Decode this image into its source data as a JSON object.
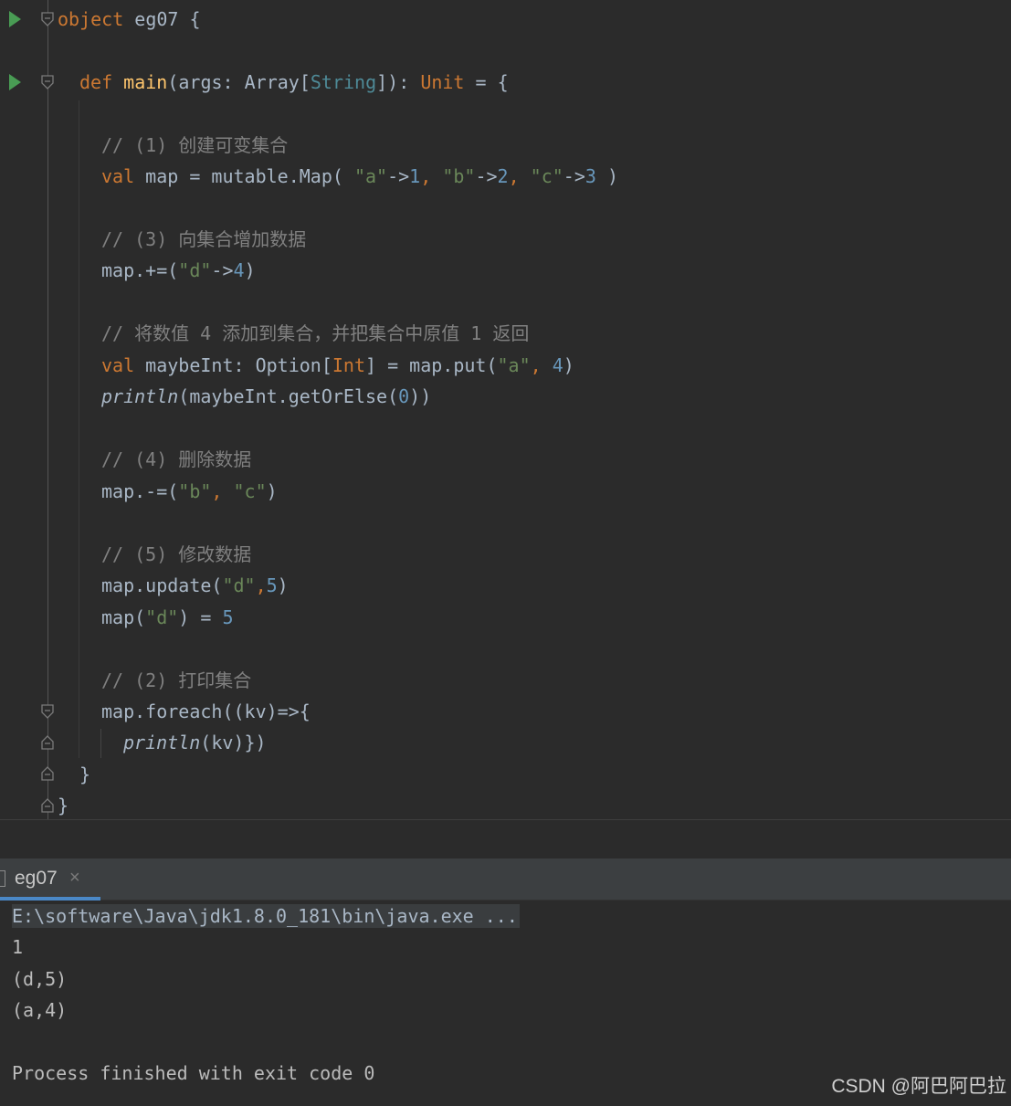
{
  "editor": {
    "lines": {
      "l1_kw": "object",
      "l1_rest": " eg07 {",
      "l2_def": "def",
      "l2_main": "main",
      "l2_a": "(args: Array[",
      "l2_string": "String",
      "l2_b": "]): ",
      "l2_unit": "Unit",
      "l2_c": " = {",
      "c1": "// (1) 创建可变集合",
      "l3_val": "val",
      "l3_a": " map = mutable.Map( ",
      "l3_s1": "\"a\"",
      "l3_arrow1": "->",
      "l3_n1": "1",
      "l3_comma1": ", ",
      "l3_s2": "\"b\"",
      "l3_arrow2": "->",
      "l3_n2": "2",
      "l3_comma2": ", ",
      "l3_s3": "\"c\"",
      "l3_arrow3": "->",
      "l3_n3": "3",
      "l3_end": " )",
      "c2": "// (3) 向集合增加数据",
      "l4_a": "map.+=(",
      "l4_s": "\"d\"",
      "l4_arrow": "->",
      "l4_n": "4",
      "l4_end": ")",
      "c3": "// 将数值 4 添加到集合，并把集合中原值 1 返回",
      "l5_val": "val",
      "l5_a": " maybeInt: Option[",
      "l5_int": "Int",
      "l5_b": "] = map.put(",
      "l5_s": "\"a\"",
      "l5_comma": ", ",
      "l5_n": "4",
      "l5_end": ")",
      "l6_println": "println",
      "l6_a": "(maybeInt.getOrElse(",
      "l6_n": "0",
      "l6_end": "))",
      "c4": "// (4) 删除数据",
      "l7_a": "map.-=(",
      "l7_s1": "\"b\"",
      "l7_comma": ", ",
      "l7_s2": "\"c\"",
      "l7_end": ")",
      "c5": "// (5) 修改数据",
      "l8_a": "map.update(",
      "l8_s": "\"d\"",
      "l8_comma": ",",
      "l8_n": "5",
      "l8_end": ")",
      "l9_a": "map(",
      "l9_s": "\"d\"",
      "l9_b": ") = ",
      "l9_n": "5",
      "c6": "// (2) 打印集合",
      "l10": "map.foreach((kv)=>{",
      "l11_println": "println",
      "l11_rest": "(kv)})",
      "l12": "}",
      "l13": "}"
    }
  },
  "run_tab": {
    "label": "eg07",
    "close": "×"
  },
  "console": {
    "command": "E:\\software\\Java\\jdk1.8.0_181\\bin\\java.exe ...",
    "output": [
      "1",
      "(d,5)",
      "(a,4)"
    ],
    "exit": "Process finished with exit code 0"
  },
  "watermark": "CSDN @阿巴阿巴拉",
  "colors": {
    "keyword": "#cc7832",
    "function": "#ffc66d",
    "string": "#6a8759",
    "number": "#6897bb",
    "type": "#4e8a97",
    "comment": "#808080",
    "default": "#a9b7c6",
    "run_icon": "#499c54",
    "background": "#2b2b2b"
  },
  "icons": [
    "run-icon",
    "fold-icon",
    "close-icon",
    "document-icon"
  ]
}
